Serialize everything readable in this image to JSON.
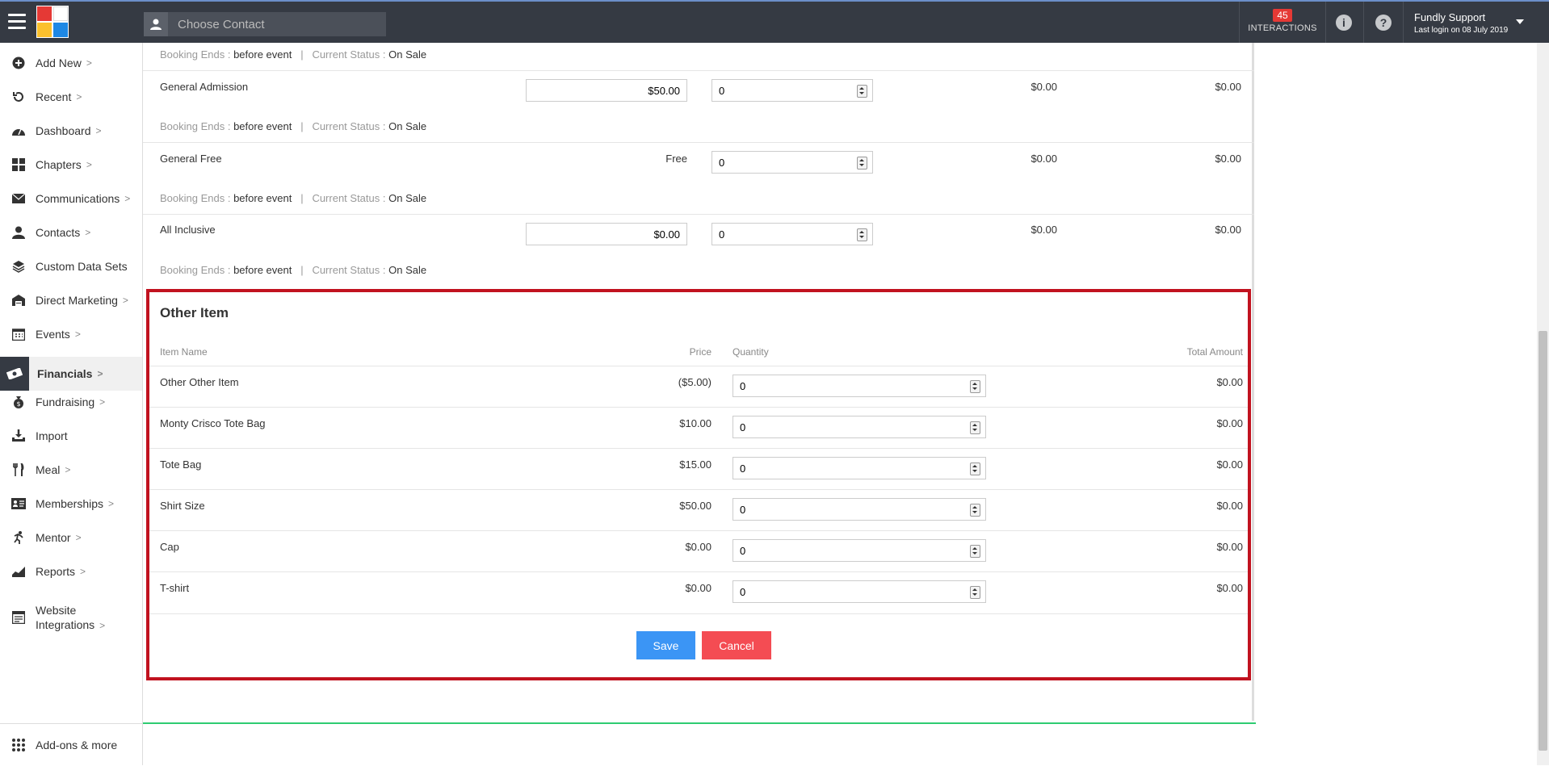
{
  "header": {
    "contact_placeholder": "Choose Contact",
    "interactions_count": "45",
    "interactions_label": "INTERACTIONS",
    "user_name": "Fundly Support",
    "last_login": "Last login on 08 July 2019"
  },
  "sidebar": {
    "items": [
      {
        "label": "Add New",
        "icon": "plus-circle-icon",
        "chevron": ">"
      },
      {
        "label": "Recent",
        "icon": "history-icon",
        "chevron": ">"
      },
      {
        "label": "Dashboard",
        "icon": "dashboard-icon",
        "chevron": ">"
      },
      {
        "label": "Chapters",
        "icon": "grid-icon",
        "chevron": ">"
      },
      {
        "label": "Communications",
        "icon": "envelope-icon",
        "chevron": ">"
      },
      {
        "label": "Contacts",
        "icon": "user-icon",
        "chevron": ">"
      },
      {
        "label": "Custom Data Sets",
        "icon": "layers-icon",
        "chevron": ""
      },
      {
        "label": "Direct Marketing",
        "icon": "warehouse-icon",
        "chevron": ">"
      },
      {
        "label": "Events",
        "icon": "calendar-icon",
        "chevron": ">"
      },
      {
        "label": "Financials",
        "icon": "money-icon",
        "chevron": ">"
      },
      {
        "label": "Fundraising",
        "icon": "money-bag-icon",
        "chevron": ">"
      },
      {
        "label": "Import",
        "icon": "import-icon",
        "chevron": ""
      },
      {
        "label": "Meal",
        "icon": "cutlery-icon",
        "chevron": ">"
      },
      {
        "label": "Memberships",
        "icon": "id-card-icon",
        "chevron": ">"
      },
      {
        "label": "Mentor",
        "icon": "running-icon",
        "chevron": ">"
      },
      {
        "label": "Reports",
        "icon": "chart-icon",
        "chevron": ">"
      },
      {
        "label_line1": "Website",
        "label_line2": "Integrations",
        "icon": "browser-icon",
        "chevron": ">"
      }
    ],
    "addons_label": "Add-ons & more"
  },
  "tickets": {
    "booking_ends_label": "Booking Ends :",
    "booking_ends_value": "before event",
    "separator": "|",
    "status_label": "Current Status :",
    "status_value": "On Sale",
    "rows": [
      {
        "name": "General Admission",
        "price": "$50.00",
        "qty": "0",
        "amount1": "$0.00",
        "amount2": "$0.00"
      },
      {
        "name": "General Free",
        "price": "Free",
        "qty": "0",
        "amount1": "$0.00",
        "amount2": "$0.00"
      },
      {
        "name": "All Inclusive",
        "price": "$0.00",
        "qty": "0",
        "amount1": "$0.00",
        "amount2": "$0.00"
      }
    ]
  },
  "other_item": {
    "title": "Other Item",
    "headers": {
      "name": "Item Name",
      "price": "Price",
      "quantity": "Quantity",
      "total": "Total Amount"
    },
    "rows": [
      {
        "name": "Other Other Item",
        "price": "($5.00)",
        "qty": "0",
        "total": "$0.00"
      },
      {
        "name": "Monty Crisco Tote Bag",
        "price": "$10.00",
        "qty": "0",
        "total": "$0.00"
      },
      {
        "name": "Tote Bag",
        "price": "$15.00",
        "qty": "0",
        "total": "$0.00"
      },
      {
        "name": "Shirt Size",
        "price": "$50.00",
        "qty": "0",
        "total": "$0.00"
      },
      {
        "name": "Cap",
        "price": "$0.00",
        "qty": "0",
        "total": "$0.00"
      },
      {
        "name": "T-shirt",
        "price": "$0.00",
        "qty": "0",
        "total": "$0.00"
      }
    ],
    "save_label": "Save",
    "cancel_label": "Cancel"
  },
  "colors": {
    "topbar": "#353a43",
    "highlight_border": "#c1121f",
    "save": "#3b95f5",
    "cancel": "#f44c53"
  }
}
